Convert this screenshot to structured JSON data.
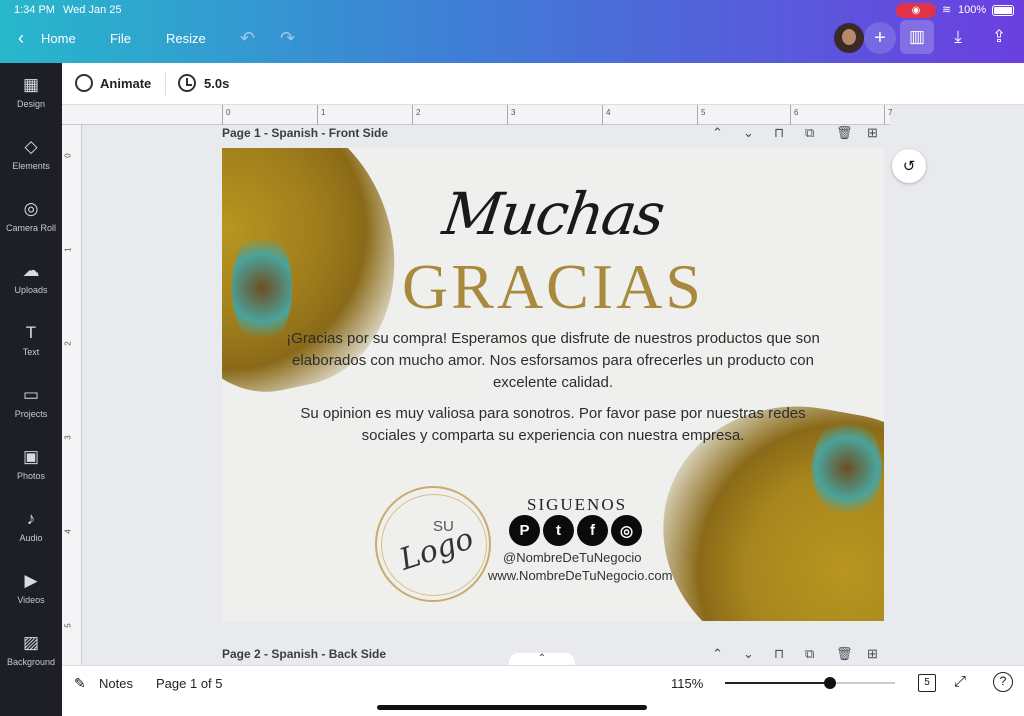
{
  "status": {
    "time": "1:34 PM",
    "date": "Wed Jan 25",
    "battery": "100%"
  },
  "nav": {
    "back_icon": "‹",
    "home": "Home",
    "file": "File",
    "resize": "Resize",
    "undo_icon": "↶",
    "redo_icon": "↷"
  },
  "topbar": {
    "plus": "+",
    "stats_icon": "▥",
    "download_icon": "⤓",
    "share_icon": "⇪"
  },
  "sidebar": {
    "items": [
      {
        "label": "Design",
        "icon": "▦"
      },
      {
        "label": "Elements",
        "icon": "◇"
      },
      {
        "label": "Camera Roll",
        "icon": "◎"
      },
      {
        "label": "Uploads",
        "icon": "☁"
      },
      {
        "label": "Text",
        "icon": "T"
      },
      {
        "label": "Projects",
        "icon": "▭"
      },
      {
        "label": "Photos",
        "icon": "▣"
      },
      {
        "label": "Audio",
        "icon": "♪"
      },
      {
        "label": "Videos",
        "icon": "▶"
      },
      {
        "label": "Background",
        "icon": "▨"
      }
    ]
  },
  "secondary": {
    "animate": "Animate",
    "duration": "5.0s"
  },
  "ruler": {
    "h": [
      "0",
      "1",
      "2",
      "3",
      "4",
      "5",
      "6",
      "7"
    ],
    "v": [
      "0",
      "1",
      "2",
      "3",
      "4",
      "5"
    ]
  },
  "pages": [
    {
      "label": "Page 1 - Spanish - Front Side"
    },
    {
      "label": "Page 2 - Spanish - Back Side"
    }
  ],
  "page_actions": {
    "up": "⌃",
    "down": "⌄",
    "lock": "⊓",
    "duplicate": "⧉",
    "delete": "🗑",
    "add": "⊞"
  },
  "design": {
    "script_title": "Muchas",
    "title": "GRACIAS",
    "paragraph1": "¡Gracias por su compra! Esperamos que disfrute de nuestros productos que son elaborados con mucho amor. Nos esforsamos para ofrecerles un producto con excelente calidad.",
    "paragraph2": "Su opinion es muy valiosa para sonotros. Por favor pase por nuestras redes sociales y comparta su experiencia con nuestra empresa.",
    "logo_su": "SU",
    "logo_text": "Logo",
    "follow": "SIGUENOS",
    "social": {
      "pinterest": "P",
      "twitter": "t",
      "facebook": "f",
      "instagram": "◎"
    },
    "handle": "@NombreDeTuNegocio",
    "website": "www.NombreDeTuNegocio.com"
  },
  "comment_icon": "↺",
  "collapse_icon": "⌃",
  "bottom": {
    "notes": "Notes",
    "notes_icon": "✎",
    "page_indicator": "Page 1 of 5",
    "zoom": "115%",
    "zoom_level": 0.62,
    "page_count": "5",
    "fullscreen_icon": "⤢",
    "help": "?"
  }
}
